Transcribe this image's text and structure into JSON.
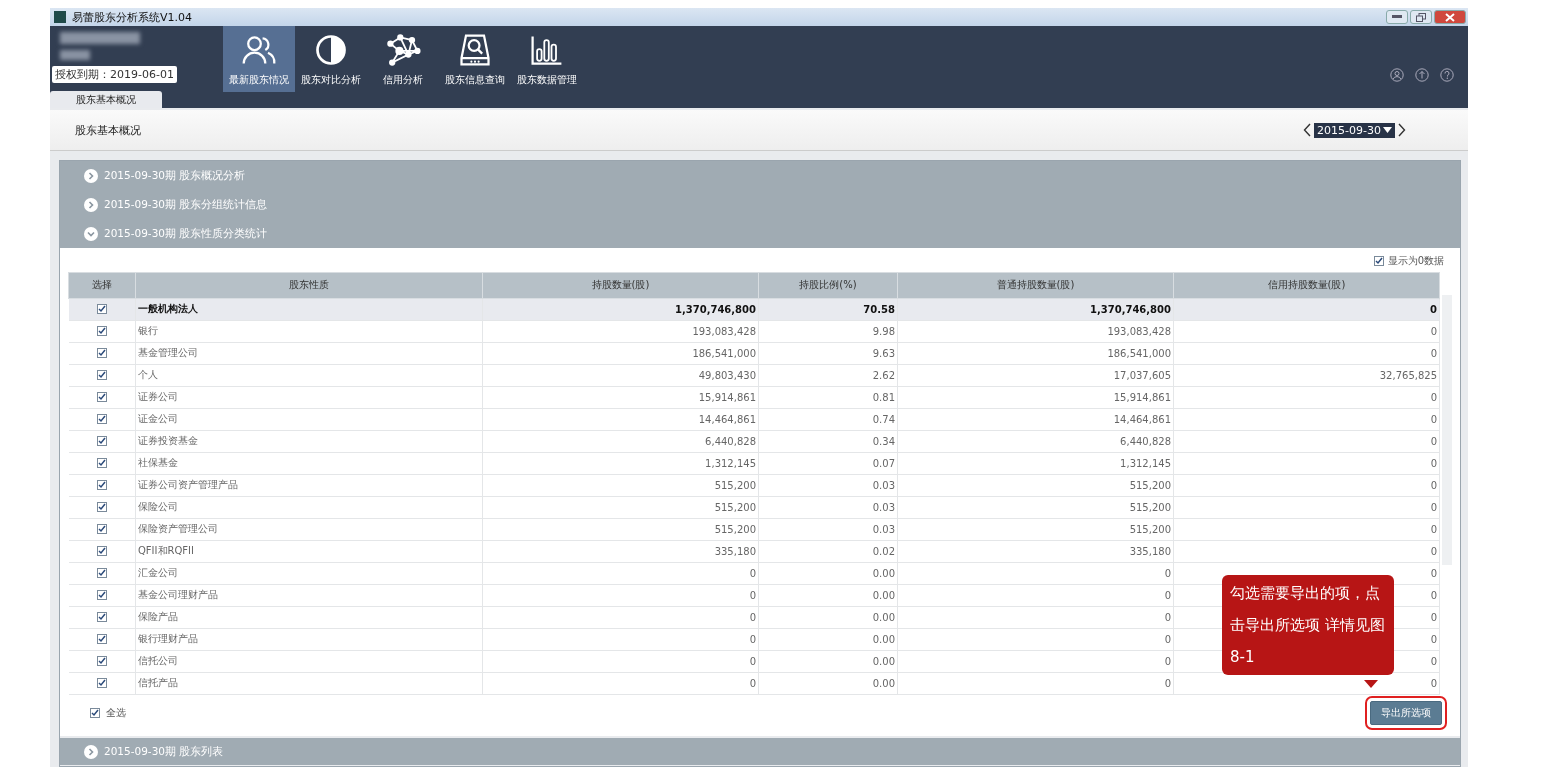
{
  "window": {
    "title": "易蕾股东分析系统V1.04"
  },
  "license": {
    "label": "授权到期：2019-06-01"
  },
  "nav": [
    {
      "label": "最新股东情况",
      "selected": true
    },
    {
      "label": "股东对比分析",
      "selected": false
    },
    {
      "label": "信用分析",
      "selected": false
    },
    {
      "label": "股东信息查询",
      "selected": false
    },
    {
      "label": "股东数据管理",
      "selected": false
    }
  ],
  "tabs": [
    {
      "label": "股东基本概况",
      "selected": true
    }
  ],
  "page_title": "股东基本概况",
  "date_picker": {
    "value": "2015-09-30"
  },
  "sections": [
    {
      "title": "2015-09-30期 股东概况分析",
      "expanded": false
    },
    {
      "title": "2015-09-30期 股东分组统计信息",
      "expanded": false
    },
    {
      "title": "2015-09-30期 股东性质分类统计",
      "expanded": true
    }
  ],
  "show_zero": {
    "label": "显示为0数据",
    "checked": true
  },
  "table": {
    "columns": [
      "选择",
      "股东性质",
      "持股数量(股)",
      "持股比例(%)",
      "普通持股数量(股)",
      "信用持股数量(股)"
    ],
    "rows": [
      {
        "checked": true,
        "selected": true,
        "cells": [
          "",
          "一般机构法人",
          "1,370,746,800",
          "70.58",
          "1,370,746,800",
          "0"
        ]
      },
      {
        "checked": true,
        "selected": false,
        "cells": [
          "",
          "银行",
          "193,083,428",
          "9.98",
          "193,083,428",
          "0"
        ]
      },
      {
        "checked": true,
        "selected": false,
        "cells": [
          "",
          "基金管理公司",
          "186,541,000",
          "9.63",
          "186,541,000",
          "0"
        ]
      },
      {
        "checked": true,
        "selected": false,
        "cells": [
          "",
          "个人",
          "49,803,430",
          "2.62",
          "17,037,605",
          "32,765,825"
        ]
      },
      {
        "checked": true,
        "selected": false,
        "cells": [
          "",
          "证券公司",
          "15,914,861",
          "0.81",
          "15,914,861",
          "0"
        ]
      },
      {
        "checked": true,
        "selected": false,
        "cells": [
          "",
          "证金公司",
          "14,464,861",
          "0.74",
          "14,464,861",
          "0"
        ]
      },
      {
        "checked": true,
        "selected": false,
        "cells": [
          "",
          "证券投资基金",
          "6,440,828",
          "0.34",
          "6,440,828",
          "0"
        ]
      },
      {
        "checked": true,
        "selected": false,
        "cells": [
          "",
          "社保基金",
          "1,312,145",
          "0.07",
          "1,312,145",
          "0"
        ]
      },
      {
        "checked": true,
        "selected": false,
        "cells": [
          "",
          "证券公司资产管理产品",
          "515,200",
          "0.03",
          "515,200",
          "0"
        ]
      },
      {
        "checked": true,
        "selected": false,
        "cells": [
          "",
          "保险公司",
          "515,200",
          "0.03",
          "515,200",
          "0"
        ]
      },
      {
        "checked": true,
        "selected": false,
        "cells": [
          "",
          "保险资产管理公司",
          "515,200",
          "0.03",
          "515,200",
          "0"
        ]
      },
      {
        "checked": true,
        "selected": false,
        "cells": [
          "",
          "QFII和RQFII",
          "335,180",
          "0.02",
          "335,180",
          "0"
        ]
      },
      {
        "checked": true,
        "selected": false,
        "cells": [
          "",
          "汇金公司",
          "0",
          "0.00",
          "0",
          "0"
        ]
      },
      {
        "checked": true,
        "selected": false,
        "cells": [
          "",
          "基金公司理财产品",
          "0",
          "0.00",
          "0",
          "0"
        ]
      },
      {
        "checked": true,
        "selected": false,
        "cells": [
          "",
          "保险产品",
          "0",
          "0.00",
          "0",
          "0"
        ]
      },
      {
        "checked": true,
        "selected": false,
        "cells": [
          "",
          "银行理财产品",
          "0",
          "0.00",
          "0",
          "0"
        ]
      },
      {
        "checked": true,
        "selected": false,
        "cells": [
          "",
          "信托公司",
          "0",
          "0.00",
          "0",
          "0"
        ]
      },
      {
        "checked": true,
        "selected": false,
        "cells": [
          "",
          "信托产品",
          "0",
          "0.00",
          "0",
          "0"
        ]
      }
    ]
  },
  "select_all": {
    "label": "全选",
    "checked": true
  },
  "export_button": "导出所选项",
  "callout": "勾选需要导出的项，点击导出所选项 详情见图 8-1",
  "last_section": {
    "title": "2015-09-30期 股东列表",
    "expanded": false
  }
}
